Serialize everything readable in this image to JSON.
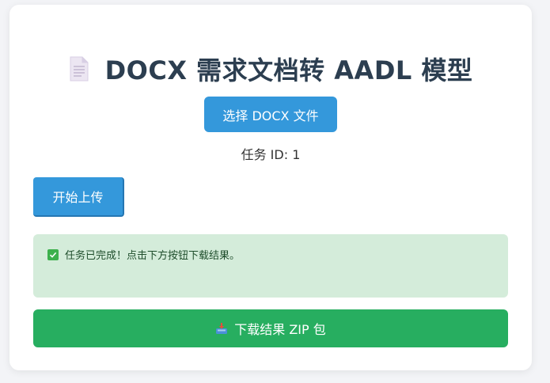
{
  "header": {
    "icon": "document-icon",
    "title": "DOCX 需求文档转 AADL 模型"
  },
  "file_select": {
    "label": "选择 DOCX 文件"
  },
  "task": {
    "id_text": "任务 ID: 1"
  },
  "upload": {
    "label": "开始上传"
  },
  "status": {
    "icon": "check-icon",
    "message": "任务已完成！点击下方按钮下载结果。"
  },
  "download": {
    "icon": "download-tray-icon",
    "label": "下载结果 ZIP 包"
  },
  "colors": {
    "primary": "#3498db",
    "success": "#27ae60",
    "status_bg": "#d4ecda",
    "title": "#2c3e50"
  }
}
